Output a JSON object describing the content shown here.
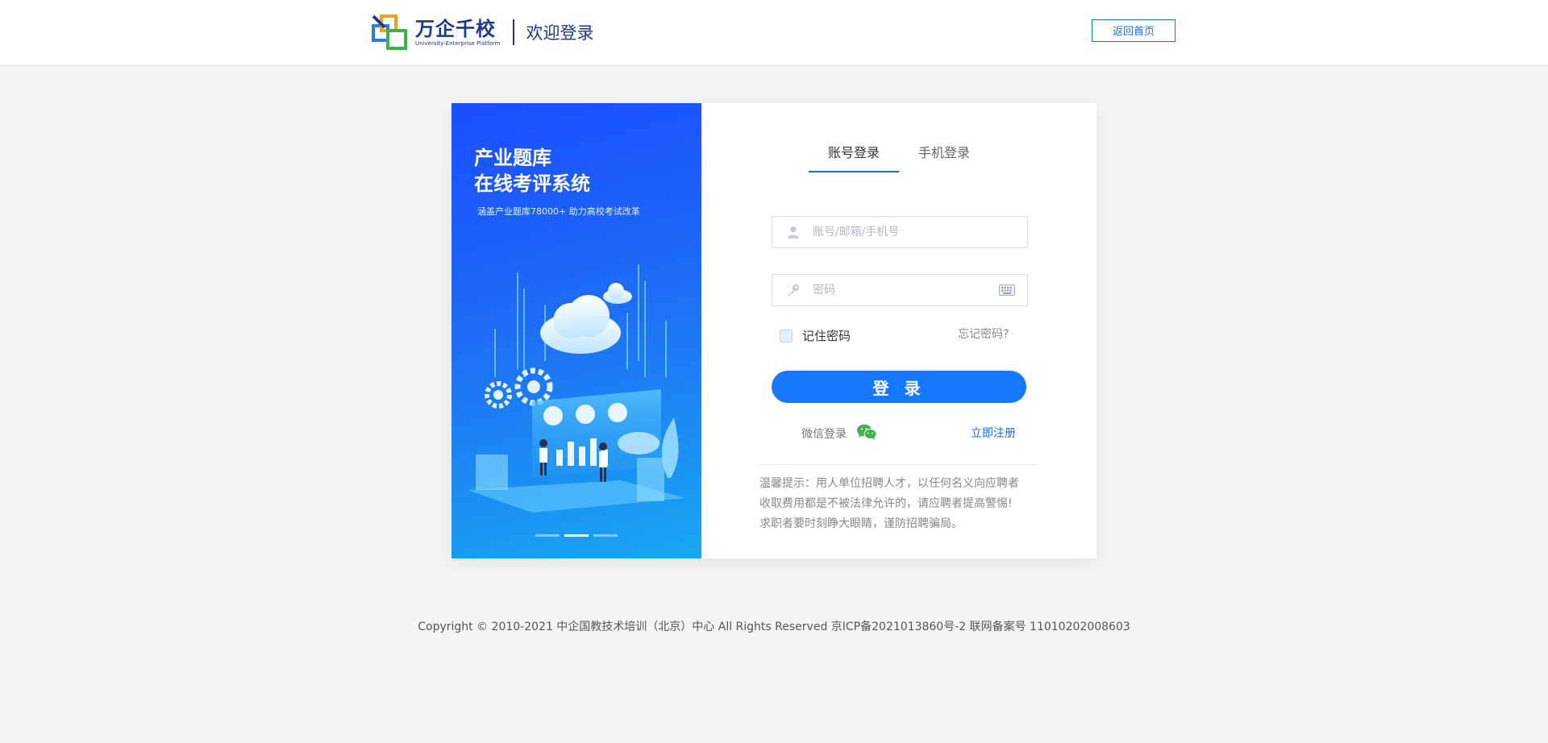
{
  "header": {
    "logo_cn": "万企千校",
    "logo_en": "University-Enterprise Platform",
    "welcome": "欢迎登录",
    "home_button": "返回首页"
  },
  "banner": {
    "title_line1": "产业题库",
    "title_line2": "在线考评系统",
    "subtitle": "涵盖产业题库78000+  助力高校考试改革",
    "carousel_active_index": 1,
    "carousel_count": 3
  },
  "tabs": [
    {
      "label": "账号登录",
      "active": true
    },
    {
      "label": "手机登录",
      "active": false
    }
  ],
  "form": {
    "account_placeholder": "账号/邮箱/手机号",
    "password_placeholder": "密码",
    "remember_label": "记住密码",
    "forgot_label": "忘记密码?",
    "login_button": "登 录",
    "wechat_label": "微信登录",
    "register_label": "立即注册"
  },
  "notice": {
    "line1": "温馨提示：用人单位招聘人才，以任何名义向应聘者",
    "line2": "收取费用都是不被法律允许的，请应聘者提高警惕!",
    "line3": "求职者要时刻睁大眼睛，谨防招聘骗局。"
  },
  "footer": {
    "text": "Copyright © 2010-2021 中企国教技术培训（北京）中心 All Rights Reserved 京ICP备2021013860号-2 联网备案号 11010202008603"
  },
  "colors": {
    "accent": "#1677ff",
    "brand_navy": "#1d3a8a",
    "banner_top": "#1a4dff",
    "banner_bottom": "#19a8f2",
    "page_bg": "#f5f5f5"
  },
  "icons": {
    "user": "user-icon",
    "key": "key-icon",
    "keyboard": "keyboard-icon",
    "wechat": "wechat-icon"
  }
}
